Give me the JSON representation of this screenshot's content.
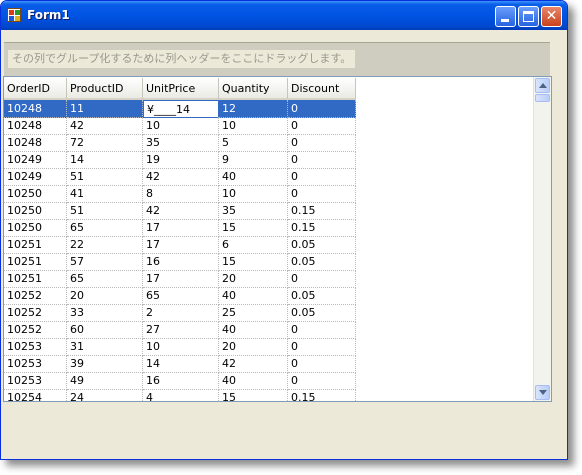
{
  "window": {
    "title": "Form1"
  },
  "group_panel": {
    "hint": "その列でグループ化するために列ヘッダーをここにドラッグします。"
  },
  "grid": {
    "columns": [
      "OrderID",
      "ProductID",
      "UnitPrice",
      "Quantity",
      "Discount"
    ],
    "edit_value": "¥____14",
    "rows": [
      [
        "10248",
        "11",
        "14",
        "12",
        "0"
      ],
      [
        "10248",
        "42",
        "10",
        "10",
        "0"
      ],
      [
        "10248",
        "72",
        "35",
        "5",
        "0"
      ],
      [
        "10249",
        "14",
        "19",
        "9",
        "0"
      ],
      [
        "10249",
        "51",
        "42",
        "40",
        "0"
      ],
      [
        "10250",
        "41",
        "8",
        "10",
        "0"
      ],
      [
        "10250",
        "51",
        "42",
        "35",
        "0.15"
      ],
      [
        "10250",
        "65",
        "17",
        "15",
        "0.15"
      ],
      [
        "10251",
        "22",
        "17",
        "6",
        "0.05"
      ],
      [
        "10251",
        "57",
        "16",
        "15",
        "0.05"
      ],
      [
        "10251",
        "65",
        "17",
        "20",
        "0"
      ],
      [
        "10252",
        "20",
        "65",
        "40",
        "0.05"
      ],
      [
        "10252",
        "33",
        "2",
        "25",
        "0.05"
      ],
      [
        "10252",
        "60",
        "27",
        "40",
        "0"
      ],
      [
        "10253",
        "31",
        "10",
        "20",
        "0"
      ],
      [
        "10253",
        "39",
        "14",
        "42",
        "0"
      ],
      [
        "10253",
        "49",
        "16",
        "40",
        "0"
      ],
      [
        "10254",
        "24",
        "4",
        "15",
        "0.15"
      ]
    ],
    "selected_row": 0
  },
  "colors": {
    "selection": "#316ac5",
    "titlebar": "#0054e3"
  }
}
